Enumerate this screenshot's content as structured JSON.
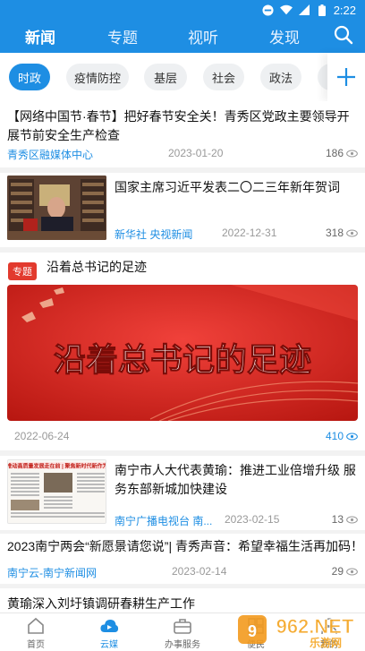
{
  "status": {
    "time": "2:22"
  },
  "topnav": {
    "tabs": [
      {
        "label": "新闻",
        "active": true
      },
      {
        "label": "专题",
        "active": false
      },
      {
        "label": "视听",
        "active": false
      },
      {
        "label": "发现",
        "active": false
      }
    ]
  },
  "channels": {
    "items": [
      {
        "label": "时政",
        "active": true
      },
      {
        "label": "疫情防控",
        "active": false
      },
      {
        "label": "基层",
        "active": false
      },
      {
        "label": "社会",
        "active": false
      },
      {
        "label": "政法",
        "active": false
      }
    ],
    "add_label": "+"
  },
  "feed": {
    "item1": {
      "title": "【网络中国节·春节】把好春节安全关！青秀区党政主要领导开展节前安全生产检查",
      "source": "青秀区融媒体中心",
      "date": "2023-01-20",
      "views": "186"
    },
    "item2": {
      "title": "国家主席习近平发表二〇二三年新年贺词",
      "source": "新华社 央视新闻",
      "date": "2022-12-31",
      "views": "318"
    },
    "item3": {
      "badge": "专题",
      "title": "沿着总书记的足迹",
      "banner_text": "沿着总书记的足迹",
      "date": "2022-06-24",
      "views": "410"
    },
    "item4": {
      "title": "南宁市人大代表黄瑜：推进工业倍增升级 服务东部新城加快建设",
      "source": "南宁广播电视台 南...",
      "date": "2023-02-15",
      "views": "13",
      "thumb_headline": "推动高质量发展走在前 | 聚焦新时代新作为"
    },
    "item5": {
      "title": "2023南宁两会“新愿景请您说”| 青秀声音：希望幸福生活再加码！",
      "source": "南宁云-南宁新闻网",
      "date": "2023-02-14",
      "views": "29"
    },
    "item6": {
      "title": "黄瑜深入刘圩镇调研春耕生产工作"
    }
  },
  "bottombar": {
    "tabs": [
      {
        "label": "首页",
        "active": false
      },
      {
        "label": "云媒",
        "active": true
      },
      {
        "label": "办事服务",
        "active": false
      },
      {
        "label": "便民",
        "active": false
      },
      {
        "label": "我的",
        "active": false
      }
    ]
  },
  "watermark": {
    "text": "962.NET",
    "subtext": "乐游网"
  },
  "colors": {
    "brand": "#1e8ee3",
    "badge": "#e23a2e",
    "banner": "#d9251d"
  }
}
